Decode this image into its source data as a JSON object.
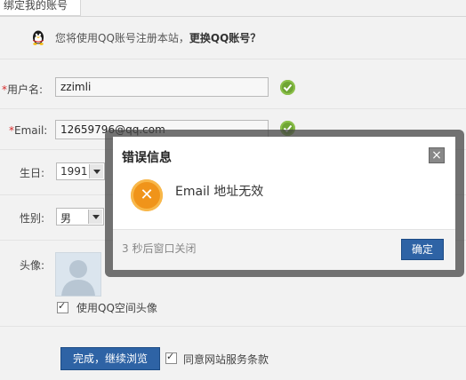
{
  "tab": {
    "label": "绑定我的账号"
  },
  "notice": {
    "text": "您将使用QQ账号注册本站，",
    "link": "更换QQ账号？"
  },
  "form": {
    "username": {
      "label": "用户名:",
      "required": "*",
      "value": "zzimli"
    },
    "email": {
      "label": "Email:",
      "required": "*",
      "value": "12659796@qq.com"
    },
    "birthday": {
      "label": "生日:",
      "year": "1991"
    },
    "gender": {
      "label": "性别:",
      "value": "男"
    },
    "avatar": {
      "label": "头像:",
      "use_qq_avatar": "使用QQ空间头像"
    },
    "finish_button": "完成，继续浏览",
    "agree_terms": "同意网站服务条款"
  },
  "dialog": {
    "title": "错误信息",
    "close": "×",
    "message": "Email 地址无效",
    "countdown": "3 秒后窗口关闭",
    "ok_button": "确定"
  },
  "colors": {
    "accent": "#2e63a5",
    "required": "#d62b2b",
    "valid": "#6fa534",
    "error_icon": "#f0941a"
  }
}
